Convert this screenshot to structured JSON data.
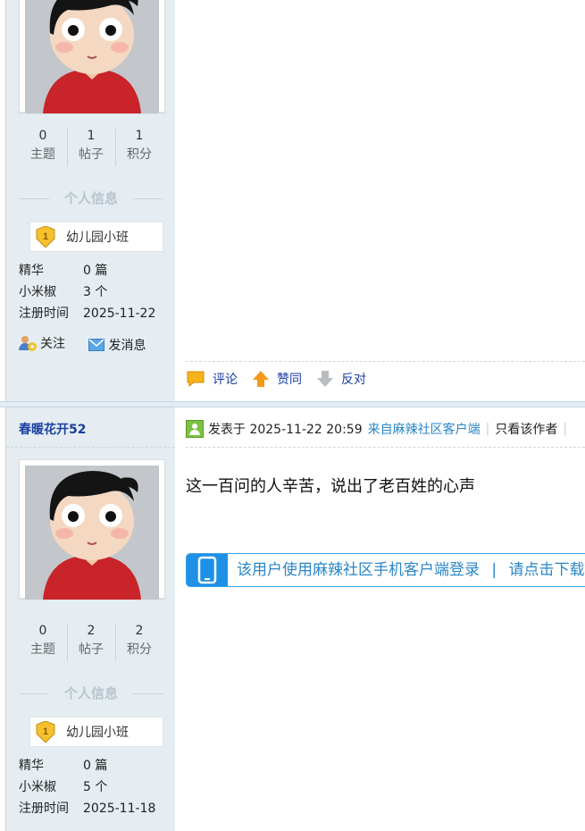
{
  "posts": [
    {
      "stats": [
        {
          "value": "0",
          "label": "主题"
        },
        {
          "value": "1",
          "label": "帖子"
        },
        {
          "value": "1",
          "label": "积分"
        }
      ],
      "info_title": "个人信息",
      "rank": "幼儿园小班",
      "rank_level": "1",
      "details": [
        {
          "key": "精华",
          "value": "0 篇"
        },
        {
          "key": "小米椒",
          "value": "3 个"
        },
        {
          "key": "注册时间",
          "value": "2025-11-22"
        }
      ],
      "actions": {
        "follow": "关注",
        "message": "发消息"
      },
      "buttons": {
        "comment": "评论",
        "agree": "赞同",
        "oppose": "反对"
      }
    },
    {
      "username": "春暖花开52",
      "meta": {
        "posted": "发表于 2025-11-22 20:59",
        "source": "来自麻辣社区客户端",
        "only_author": "只看该作者",
        "cut": "|"
      },
      "content": "这一百问的人辛苦，说出了老百姓的心声",
      "banner": {
        "part1": "该用户使用麻辣社区手机客户端登录",
        "divider": "|",
        "part2": "请点击下载"
      },
      "stats": [
        {
          "value": "0",
          "label": "主题"
        },
        {
          "value": "2",
          "label": "帖子"
        },
        {
          "value": "2",
          "label": "积分"
        }
      ],
      "info_title": "个人信息",
      "rank": "幼儿园小班",
      "rank_level": "1",
      "details": [
        {
          "key": "精华",
          "value": "0 篇"
        },
        {
          "key": "小米椒",
          "value": "5 个"
        },
        {
          "key": "注册时间",
          "value": "2025-11-18"
        }
      ]
    }
  ],
  "colors": {
    "accent": "#1a3fa0",
    "link": "#2a86c8",
    "sidebar": "#e5edf2"
  }
}
